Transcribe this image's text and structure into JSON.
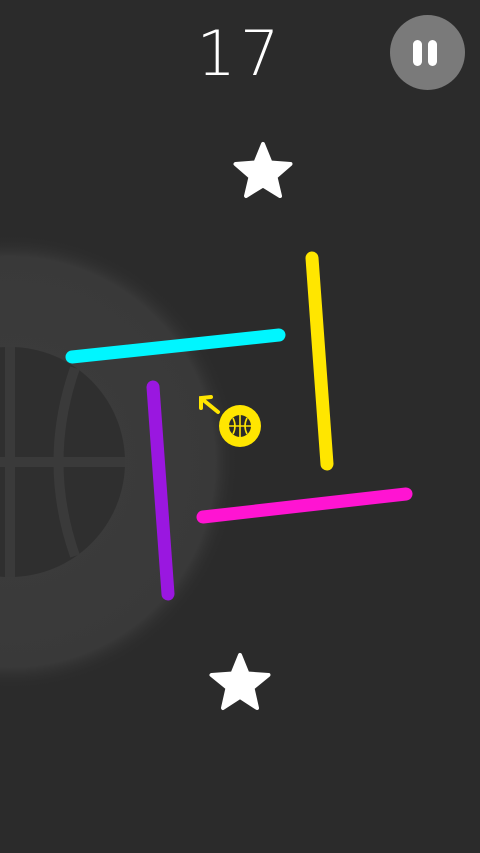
{
  "hud": {
    "score": "17",
    "pause_icon": "pause-icon"
  },
  "colors": {
    "background": "#2b2b2b",
    "cyan_bar": "#00f6ff",
    "yellow_bar": "#ffe600",
    "magenta_bar": "#ff14d2",
    "purple_bar": "#9a17e0",
    "ball": "#ffe600",
    "star": "#ffffff",
    "pause_button": "#7a7a7a"
  },
  "icons": {
    "top_star": "star-icon",
    "bottom_star": "star-icon",
    "ball": "basketball-icon",
    "direction": "arrow-icon",
    "background_ball": "basketball-icon"
  }
}
